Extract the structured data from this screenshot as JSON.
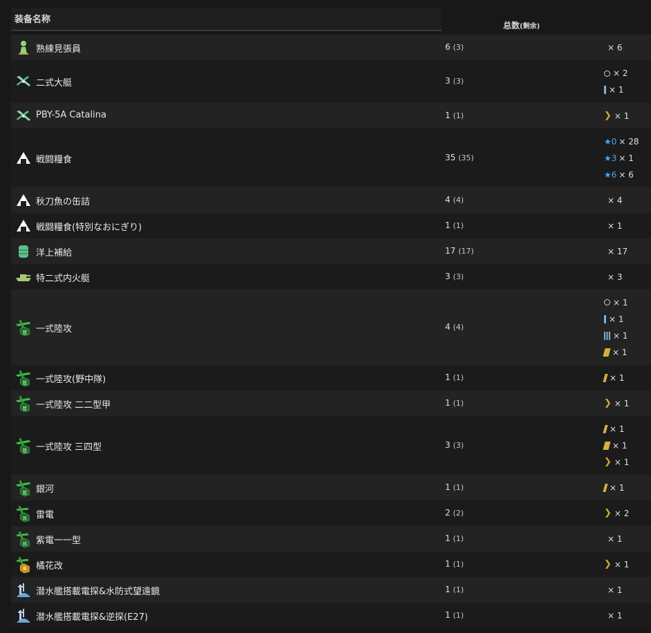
{
  "header": {
    "name_label": "装备名称",
    "count_label": "总数",
    "remain_label": "(剩余)"
  },
  "rows": [
    {
      "name": "熟練見張員",
      "icon": "lookout-icon",
      "count": "6",
      "remain": "(3)",
      "improvements": [
        {
          "marker": "",
          "text": "× 6"
        }
      ]
    },
    {
      "name": "二式大艇",
      "icon": "flying-boat-icon",
      "count": "3",
      "remain": "(3)",
      "improvements": [
        {
          "marker": "circle",
          "text": "× 2"
        },
        {
          "marker": "bar1",
          "text": "× 1"
        }
      ]
    },
    {
      "name": "PBY-5A Catalina",
      "icon": "flying-boat-icon",
      "count": "1",
      "remain": "(1)",
      "improvements": [
        {
          "marker": "chevron",
          "text": "× 1"
        }
      ]
    },
    {
      "name": "戦闘糧食",
      "icon": "ration-icon",
      "count": "35",
      "remain": "(35)",
      "improvements": [
        {
          "marker": "star",
          "star": "★0",
          "text": "× 28"
        },
        {
          "marker": "star",
          "star": "★3",
          "text": "× 1"
        },
        {
          "marker": "star",
          "star": "★6",
          "text": "× 6"
        }
      ]
    },
    {
      "name": "秋刀魚の缶詰",
      "icon": "ration-icon",
      "count": "4",
      "remain": "(4)",
      "improvements": [
        {
          "marker": "",
          "text": "× 4"
        }
      ]
    },
    {
      "name": "戦闘糧食(特別なおにぎり)",
      "icon": "ration-icon",
      "count": "1",
      "remain": "(1)",
      "improvements": [
        {
          "marker": "",
          "text": "× 1"
        }
      ]
    },
    {
      "name": "洋上補給",
      "icon": "supply-drum-icon",
      "count": "17",
      "remain": "(17)",
      "improvements": [
        {
          "marker": "",
          "text": "× 17"
        }
      ]
    },
    {
      "name": "特二式内火艇",
      "icon": "tank-boat-icon",
      "count": "3",
      "remain": "(3)",
      "improvements": [
        {
          "marker": "",
          "text": "× 3"
        }
      ]
    },
    {
      "name": "一式陸攻",
      "icon": "land-bomber-icon",
      "count": "4",
      "remain": "(4)",
      "improvements": [
        {
          "marker": "circle",
          "text": "× 1"
        },
        {
          "marker": "bar1",
          "text": "× 1"
        },
        {
          "marker": "bar3",
          "text": "× 1"
        },
        {
          "marker": "slash2",
          "text": "× 1"
        }
      ]
    },
    {
      "name": "一式陸攻(野中隊)",
      "icon": "land-bomber-icon",
      "count": "1",
      "remain": "(1)",
      "improvements": [
        {
          "marker": "slash1",
          "text": "× 1"
        }
      ]
    },
    {
      "name": "一式陸攻 二二型甲",
      "icon": "land-bomber-icon",
      "count": "1",
      "remain": "(1)",
      "improvements": [
        {
          "marker": "chevron",
          "text": "× 1"
        }
      ]
    },
    {
      "name": "一式陸攻 三四型",
      "icon": "land-bomber-icon",
      "count": "3",
      "remain": "(3)",
      "improvements": [
        {
          "marker": "slash1",
          "text": "× 1"
        },
        {
          "marker": "slash2",
          "text": "× 1"
        },
        {
          "marker": "chevron",
          "text": "× 1"
        }
      ]
    },
    {
      "name": "銀河",
      "icon": "land-bomber-icon",
      "count": "1",
      "remain": "(1)",
      "improvements": [
        {
          "marker": "slash1",
          "text": "× 1"
        }
      ]
    },
    {
      "name": "雷電",
      "icon": "interceptor-icon",
      "count": "2",
      "remain": "(2)",
      "improvements": [
        {
          "marker": "chevron",
          "text": "× 2"
        }
      ]
    },
    {
      "name": "紫電一一型",
      "icon": "interceptor-icon",
      "count": "1",
      "remain": "(1)",
      "improvements": [
        {
          "marker": "",
          "text": "× 1"
        }
      ]
    },
    {
      "name": "橘花改",
      "icon": "jet-icon",
      "count": "1",
      "remain": "(1)",
      "improvements": [
        {
          "marker": "chevron",
          "text": "× 1"
        }
      ]
    },
    {
      "name": "潜水艦搭載電探&水防式望遠鏡",
      "icon": "submarine-radar-icon",
      "count": "1",
      "remain": "(1)",
      "improvements": [
        {
          "marker": "",
          "text": "× 1"
        }
      ]
    },
    {
      "name": "潜水艦搭載電探&逆探(E27)",
      "icon": "submarine-radar-icon",
      "count": "1",
      "remain": "(1)",
      "improvements": [
        {
          "marker": "",
          "text": "× 1"
        }
      ]
    }
  ]
}
